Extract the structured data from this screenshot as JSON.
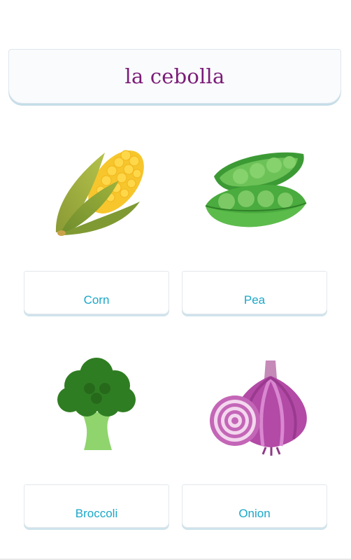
{
  "prompt": {
    "word": "la cebolla"
  },
  "options": [
    {
      "label": "Corn",
      "icon": "corn-icon"
    },
    {
      "label": "Pea",
      "icon": "pea-pod-icon"
    },
    {
      "label": "Broccoli",
      "icon": "broccoli-icon"
    },
    {
      "label": "Onion",
      "icon": "red-onion-icon"
    }
  ],
  "colors": {
    "prompt_text": "#7b1c78",
    "option_text": "#1aa7c9",
    "card_shadow": "#c5dde8"
  }
}
